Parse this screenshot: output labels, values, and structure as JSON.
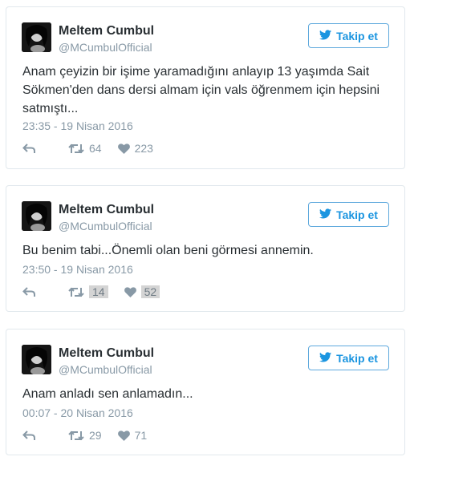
{
  "tweets": [
    {
      "name": "Meltem Cumbul",
      "handle": "@MCumbulOfficial",
      "follow_label": "Takip et",
      "text": "Anam çeyizin bir işime yaramadığını anlayıp 13 yaşımda Sait Sökmen'den dans dersi almam için vals öğrenmem için hepsini satmıştı...",
      "timestamp": "23:35 - 19 Nisan 2016",
      "retweets": "64",
      "likes": "223"
    },
    {
      "name": "Meltem Cumbul",
      "handle": "@MCumbulOfficial",
      "follow_label": "Takip et",
      "text": "Bu benim tabi...Önemli olan beni görmesi annemin.",
      "timestamp": "23:50 - 19 Nisan 2016",
      "retweets": "14",
      "likes": "52"
    },
    {
      "name": "Meltem Cumbul",
      "handle": "@MCumbulOfficial",
      "follow_label": "Takip et",
      "text": "Anam anladı sen anlamadın...",
      "timestamp": "00:07 - 20 Nisan 2016",
      "retweets": "29",
      "likes": "71"
    }
  ],
  "colors": {
    "follow_blue": "#1b95e0",
    "meta_gray": "#8899a6",
    "border": "#e1e8ed"
  },
  "icons": {
    "follow": "twitter-bird-icon",
    "reply": "reply-icon",
    "retweet": "retweet-icon",
    "like": "heart-icon"
  }
}
